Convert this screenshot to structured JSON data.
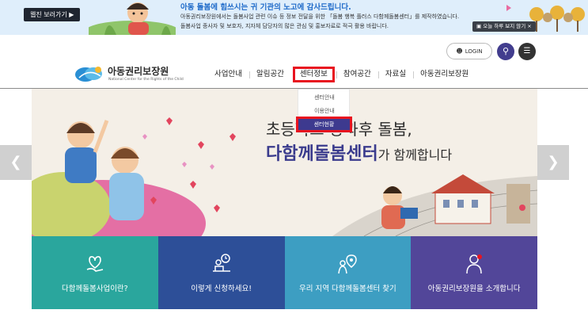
{
  "banner": {
    "webzine_label": "웹진 보러가기 ▶",
    "title": "아동 돌봄에 힘쓰시는 귀 기관의 노고에 감사드립니다.",
    "line1": "아동권리보장원에서는 돌봄사업 관련 이슈 등 정보 전달을 위한 「돌봄 행복 플러스 다함께돌봄센터」를 제작하였습니다.",
    "line2": "돌봄사업 종사자 및 보호자, 지자체 담당자의 많은 관심 및 홍보자료로 적극 활용 바랍니다.",
    "today_close": "▣ 오늘 하루 보지 않기  ×"
  },
  "header": {
    "login_label": "LOGIN",
    "logo_ko": "아동권리보장원",
    "logo_en": "National Center for the Rights of the Child"
  },
  "nav": {
    "items": [
      "사업안내",
      "알림공간",
      "센터정보",
      "참여공간",
      "자료실",
      "아동권리보장원"
    ],
    "dropdown": [
      "센터안내",
      "이용안내",
      "센터현황"
    ]
  },
  "hero": {
    "line1": "초등학교 방과후 돌봄,",
    "line2_bold": "다함께돌봄센터",
    "line2_rest": "가 함께합니다"
  },
  "tiles": [
    {
      "label": "다함께돌봄사업이란?",
      "color": "#2aa69d",
      "icon": "heart-hand-icon"
    },
    {
      "label": "이렇게 신청하세요!",
      "color": "#2d4f98",
      "icon": "desk-clock-icon"
    },
    {
      "label": "우리 지역 다함께돌봄센터 찾기",
      "color": "#3d9ec2",
      "icon": "location-person-icon"
    },
    {
      "label": "아동권리보장원을 소개합니다",
      "color": "#524699",
      "icon": "person-badge-icon"
    }
  ],
  "colors": {
    "brand_purple": "#3d3a8f",
    "highlight_red": "#e8141f"
  }
}
